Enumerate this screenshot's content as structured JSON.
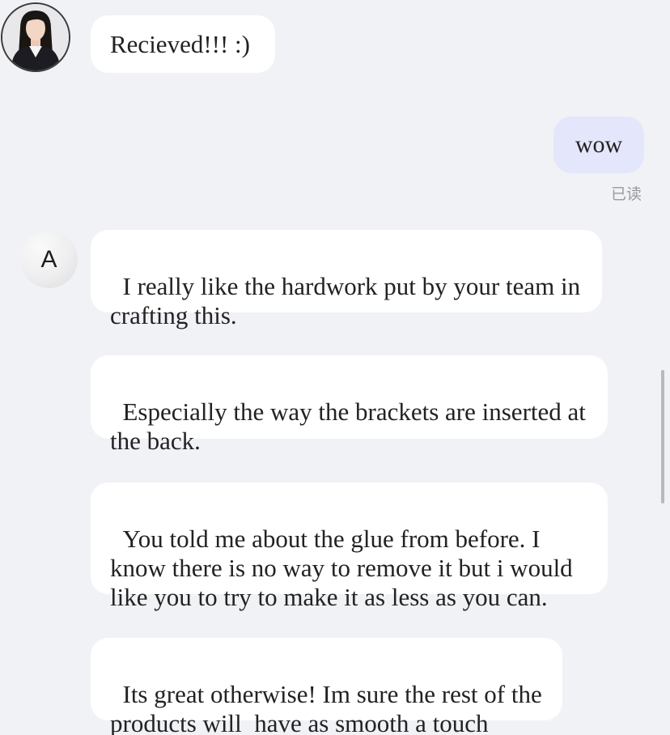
{
  "avatar_letter": "A",
  "messages": [
    {
      "side": "incoming",
      "text": "Recieved!!! :)"
    },
    {
      "side": "outgoing",
      "text": "wow",
      "status": "已读"
    },
    {
      "side": "incoming",
      "text": "I really like the hardwork put by your team in crafting this."
    },
    {
      "side": "incoming",
      "text": "Especially the way the brackets are inserted at the back."
    },
    {
      "side": "incoming",
      "text": "You told me about the glue from before. I know there is no way to remove it but i would like you to try to make it as less as you can."
    },
    {
      "side": "incoming",
      "text": "Its great otherwise! Im sure the rest of the products will  have as smooth a touch"
    }
  ],
  "colors": {
    "background": "#f1f2f6",
    "incoming_bubble": "#ffffff",
    "outgoing_bubble": "#e4e6fb",
    "read_status": "#9a9a9a"
  }
}
